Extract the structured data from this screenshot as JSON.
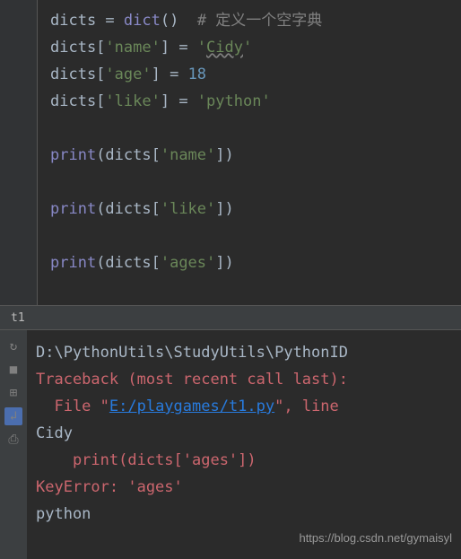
{
  "editor": {
    "lines": [
      {
        "segments": [
          {
            "t": "dicts ",
            "c": "ident"
          },
          {
            "t": "= ",
            "c": "op"
          },
          {
            "t": "dict",
            "c": "builtin"
          },
          {
            "t": "()  ",
            "c": "paren"
          },
          {
            "t": "# 定义一个空字典",
            "c": "comment"
          }
        ]
      },
      {
        "segments": [
          {
            "t": "dicts[",
            "c": "ident"
          },
          {
            "t": "'name'",
            "c": "string"
          },
          {
            "t": "] = ",
            "c": "ident"
          },
          {
            "t": "'",
            "c": "string"
          },
          {
            "t": "Cidy",
            "c": "string-u"
          },
          {
            "t": "'",
            "c": "string"
          }
        ]
      },
      {
        "segments": [
          {
            "t": "dicts[",
            "c": "ident"
          },
          {
            "t": "'age'",
            "c": "string"
          },
          {
            "t": "] = ",
            "c": "ident"
          },
          {
            "t": "18",
            "c": "number"
          }
        ]
      },
      {
        "segments": [
          {
            "t": "dicts[",
            "c": "ident"
          },
          {
            "t": "'like'",
            "c": "string"
          },
          {
            "t": "] = ",
            "c": "ident"
          },
          {
            "t": "'python'",
            "c": "string"
          }
        ]
      },
      {
        "segments": [
          {
            "t": " ",
            "c": "ident"
          }
        ]
      },
      {
        "segments": [
          {
            "t": "print",
            "c": "builtin"
          },
          {
            "t": "(dicts[",
            "c": "ident"
          },
          {
            "t": "'name'",
            "c": "string"
          },
          {
            "t": "])",
            "c": "ident"
          }
        ]
      },
      {
        "segments": [
          {
            "t": " ",
            "c": "ident"
          }
        ]
      },
      {
        "segments": [
          {
            "t": "print",
            "c": "builtin"
          },
          {
            "t": "(dicts[",
            "c": "ident"
          },
          {
            "t": "'like'",
            "c": "string"
          },
          {
            "t": "])",
            "c": "ident"
          }
        ]
      },
      {
        "segments": [
          {
            "t": " ",
            "c": "ident"
          }
        ]
      },
      {
        "segments": [
          {
            "t": "print",
            "c": "builtin"
          },
          {
            "t": "(dicts[",
            "c": "ident"
          },
          {
            "t": "'ages'",
            "c": "string"
          },
          {
            "t": "])",
            "c": "ident"
          }
        ]
      }
    ]
  },
  "tab": {
    "label": "t1"
  },
  "console": {
    "lines": [
      {
        "segments": [
          {
            "t": "D:\\PythonUtils\\StudyUtils\\PythonID",
            "c": "ident"
          }
        ]
      },
      {
        "segments": [
          {
            "t": "Traceback (most recent call last):",
            "c": "err"
          }
        ]
      },
      {
        "segments": [
          {
            "t": "  File \"",
            "c": "err"
          },
          {
            "t": "E:/playgames/t1.py",
            "c": "link"
          },
          {
            "t": "\", line",
            "c": "err"
          }
        ]
      },
      {
        "segments": [
          {
            "t": "Cidy",
            "c": "ident"
          }
        ]
      },
      {
        "segments": [
          {
            "t": "    print(dicts['ages'])",
            "c": "err"
          }
        ]
      },
      {
        "segments": [
          {
            "t": "KeyError: 'ages'",
            "c": "err"
          }
        ]
      },
      {
        "segments": [
          {
            "t": "python",
            "c": "ident"
          }
        ]
      }
    ]
  },
  "watermark": "https://blog.csdn.net/gymaisyl"
}
